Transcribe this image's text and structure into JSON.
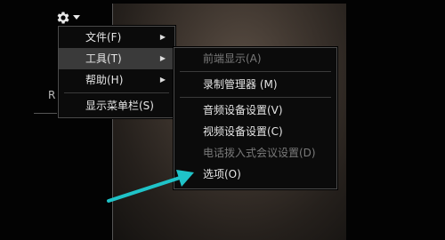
{
  "menu_bar": {
    "gear_icon": "gear-icon",
    "dropdown_icon": "caret-down-icon"
  },
  "main_menu": {
    "items": [
      {
        "label": "文件(F)",
        "has_submenu": true
      },
      {
        "label": "工具(T)",
        "has_submenu": true,
        "highlighted": true
      },
      {
        "label": "帮助(H)",
        "has_submenu": true
      },
      {
        "label": "显示菜单栏(S)",
        "has_submenu": false
      }
    ]
  },
  "tools_submenu": {
    "items": [
      {
        "label": "前端显示(A)",
        "enabled": false
      },
      {
        "label": "录制管理器 (M)",
        "enabled": true
      },
      {
        "label": "音频设备设置(V)",
        "enabled": true
      },
      {
        "label": "视频设备设置(C)",
        "enabled": true
      },
      {
        "label": "电话拨入式会议设置(D)",
        "enabled": false
      },
      {
        "label": "选项(O)",
        "enabled": true
      }
    ]
  },
  "background": {
    "left_edge_glyph": "R"
  },
  "annotation": {
    "arrow_color": "#1fc3c8"
  }
}
